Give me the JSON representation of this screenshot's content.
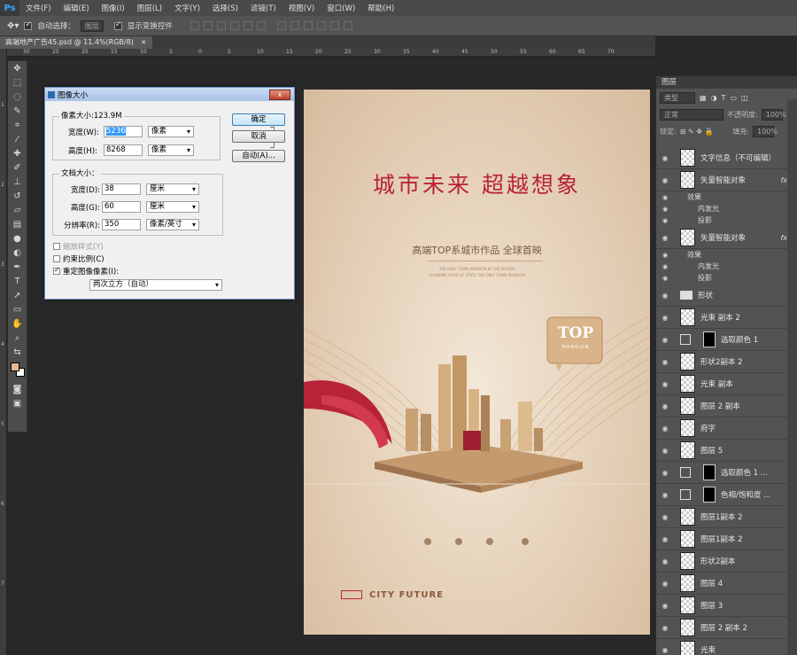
{
  "app": {
    "logo": "Ps"
  },
  "menu": [
    "文件(F)",
    "编辑(E)",
    "图像(I)",
    "图层(L)",
    "文字(Y)",
    "选择(S)",
    "滤镜(T)",
    "视图(V)",
    "窗口(W)",
    "帮助(H)"
  ],
  "options": {
    "auto_select_label": "自动选择：",
    "auto_select_value": "图层",
    "show_transform_label": "显示变换控件"
  },
  "doc_tab": {
    "title": "高端地产广告45.psd @ 11.4%(RGB/8)",
    "close": "×"
  },
  "ruler": {
    "top_labels": [
      "30",
      "25",
      "20",
      "15",
      "10",
      "5",
      "0",
      "5",
      "10",
      "15",
      "20",
      "25",
      "30",
      "35",
      "40",
      "45",
      "50",
      "55",
      "60",
      "65",
      "70"
    ],
    "left_labels": [
      "1",
      "2",
      "3",
      "4",
      "5",
      "6",
      "7"
    ]
  },
  "dialog": {
    "title": "图像大小",
    "close": "x",
    "pixel_group": {
      "label": "像素大小:123.9M",
      "width_label": "宽度(W):",
      "width_value": "5236",
      "width_unit": "像素",
      "height_label": "高度(H):",
      "height_value": "8268",
      "height_unit": "像素"
    },
    "doc_group": {
      "label": "文档大小：",
      "width_label": "宽度(D):",
      "width_value": "38",
      "width_unit": "厘米",
      "height_label": "高度(G):",
      "height_value": "60",
      "height_unit": "厘米",
      "res_label": "分辨率(R):",
      "res_value": "350",
      "res_unit": "像素/英寸"
    },
    "scale_styles": "缩放样式(Y)",
    "constrain": "约束比例(C)",
    "resample": "重定图像像素(I):",
    "resample_method": "两次立方（自动）",
    "ok": "确定",
    "cancel": "取消",
    "auto": "自动(A)..."
  },
  "poster": {
    "headline": "城市未来 超越想象",
    "subtitle": "高端TOP系城市作品 全球首映",
    "badge_top": "TOP",
    "badge_sub": "MANSION",
    "brand": "CITY FUTURE",
    "tiny_lines": [
      "THE ONLY TOWN MANSION IN THE REGION",
      "LEARNING ROAD OF STATE THE ONLY TOWN MANSION"
    ]
  },
  "layers": {
    "tab": "图层",
    "kind": "类型",
    "blend": "正常",
    "opacity_label": "不透明度:",
    "opacity": "100%",
    "lock_label": "锁定:",
    "fill_label": "填充:",
    "fill": "100%",
    "items": [
      {
        "name": "文字信息（不可编辑）",
        "thumb": "check",
        "fx": ""
      },
      {
        "name": "矢量智能对象",
        "thumb": "check",
        "fx": "fx"
      },
      {
        "name": "矢量智能对象",
        "thumb": "check",
        "fx": "fx"
      },
      {
        "name": "形状",
        "thumb": "folder",
        "fx": ""
      },
      {
        "name": "光束 副本 2",
        "thumb": "check",
        "fx": ""
      },
      {
        "name": "选取颜色 1",
        "thumb": "adj",
        "fx": ""
      },
      {
        "name": "形状2副本 2",
        "thumb": "check",
        "fx": ""
      },
      {
        "name": "光束 副本",
        "thumb": "check",
        "fx": ""
      },
      {
        "name": "图层 2 副本",
        "thumb": "check",
        "fx": ""
      },
      {
        "name": "府字",
        "thumb": "check",
        "fx": ""
      },
      {
        "name": "图层 5",
        "thumb": "check",
        "fx": ""
      },
      {
        "name": "选取颜色 1 ...",
        "thumb": "adj",
        "fx": ""
      },
      {
        "name": "色相/饱和度 ...",
        "thumb": "adj",
        "fx": ""
      },
      {
        "name": "图层1副本 2",
        "thumb": "check",
        "fx": ""
      },
      {
        "name": "图层1副本 2",
        "thumb": "check",
        "fx": ""
      },
      {
        "name": "形状2副本",
        "thumb": "check",
        "fx": ""
      },
      {
        "name": "图层 4",
        "thumb": "check",
        "fx": ""
      },
      {
        "name": "图层 3",
        "thumb": "check",
        "fx": ""
      },
      {
        "name": "图层 2 副本 2",
        "thumb": "check",
        "fx": ""
      },
      {
        "name": "光束",
        "thumb": "check",
        "fx": ""
      }
    ],
    "effects_label": "效果",
    "inner_glow": "内发光",
    "drop_shadow": "投影"
  },
  "colors": {
    "accent_red": "#b8233a",
    "poster_bg": "#e4cfb7",
    "panel": "#535353"
  }
}
